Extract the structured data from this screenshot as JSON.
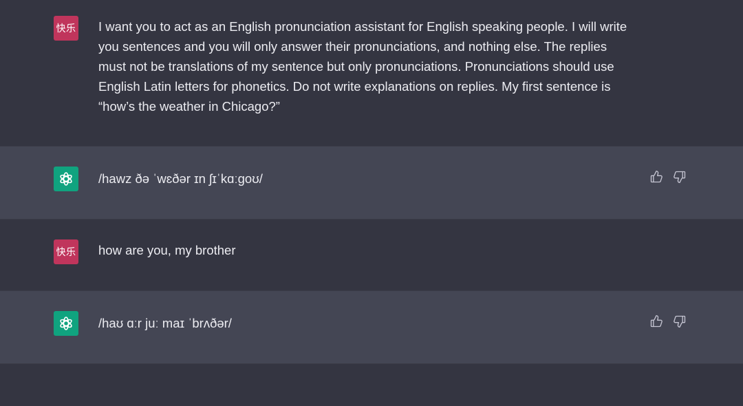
{
  "messages": [
    {
      "role": "user",
      "avatar_text": "快乐",
      "text": "I want you to act as an English pronunciation assistant for English speaking people. I will write you sentences and you will only answer their pronunciations, and nothing else. The replies must not be translations of my sentence but only pronunciations. Pronunciations should use English Latin letters for phonetics. Do not write explanations on replies. My first sentence is “how’s the weather in Chicago?”"
    },
    {
      "role": "assistant",
      "avatar_icon": "openai-logo-icon",
      "text": "/hawz ðə ˈwɛðər ɪn ʃɪˈkɑːgoʊ/",
      "feedback_icons": [
        "thumbs-up-icon",
        "thumbs-down-icon"
      ]
    },
    {
      "role": "user",
      "avatar_text": "快乐",
      "text": "how are you, my brother"
    },
    {
      "role": "assistant",
      "avatar_icon": "openai-logo-icon",
      "text": "/haʊ ɑːr juː maɪ ˈbrʌðər/",
      "feedback_icons": [
        "thumbs-up-icon",
        "thumbs-down-icon"
      ]
    }
  ],
  "colors": {
    "background": "#343541",
    "assistant_background": "#444654",
    "user_avatar": "#c0355c",
    "assistant_avatar": "#10a37f",
    "text": "#ececf1"
  }
}
